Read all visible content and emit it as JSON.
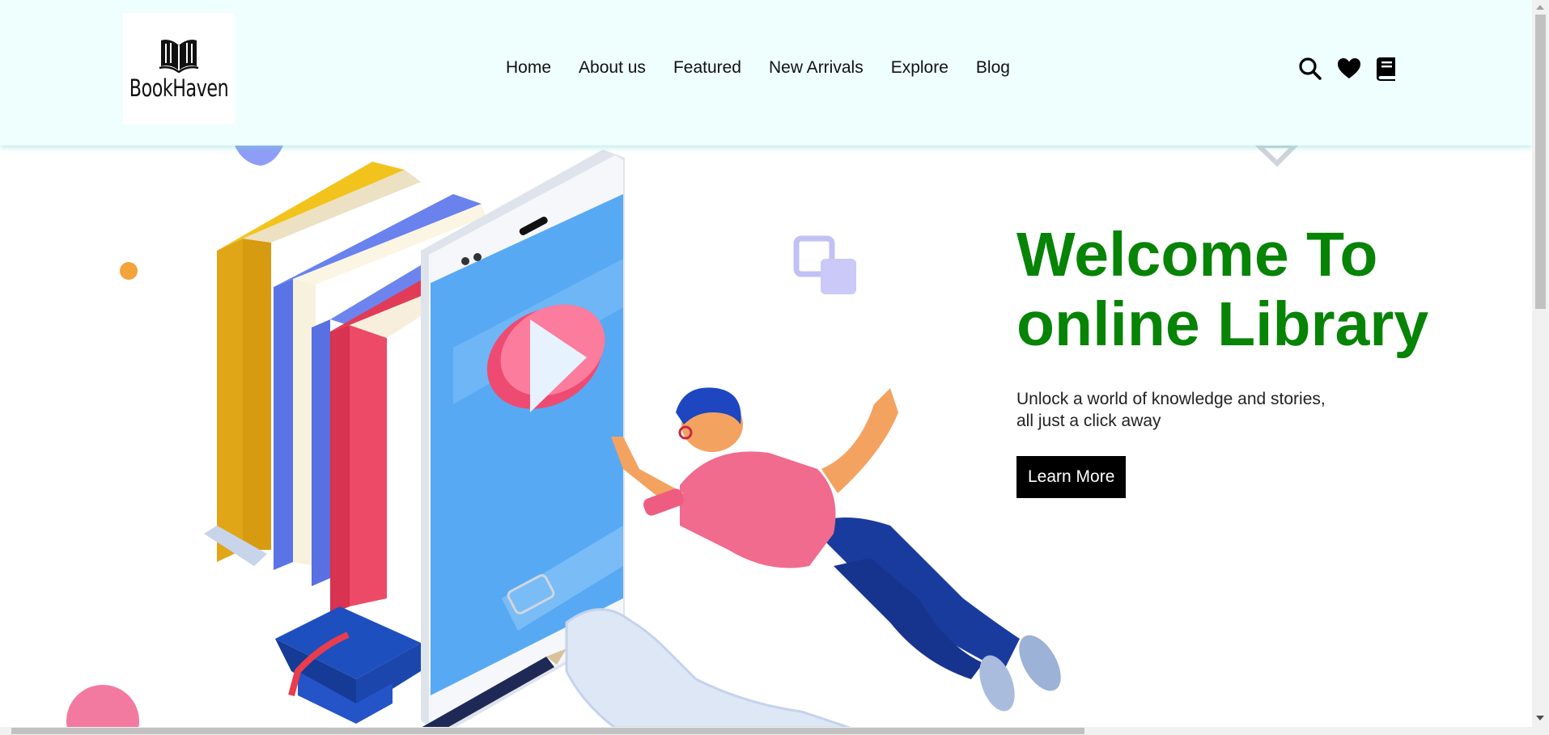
{
  "brand": {
    "name": "BookHaven",
    "icon": "open-book-icon"
  },
  "nav": {
    "items": [
      {
        "label": "Home"
      },
      {
        "label": "About us"
      },
      {
        "label": "Featured"
      },
      {
        "label": "New Arrivals"
      },
      {
        "label": "Explore"
      },
      {
        "label": "Blog"
      }
    ]
  },
  "header_icons": [
    "search-icon",
    "heart-icon",
    "book-icon"
  ],
  "hero": {
    "title_line1": "Welcome To",
    "title_line2": "online Library",
    "subtitle_line1": "Unlock a world of knowledge and stories,",
    "subtitle_line2": "all just a click away",
    "button_label": "Learn More"
  },
  "colors": {
    "header_bg": "#eefffe",
    "title": "#078306",
    "button_bg": "#000000",
    "button_text": "#ffffff"
  }
}
